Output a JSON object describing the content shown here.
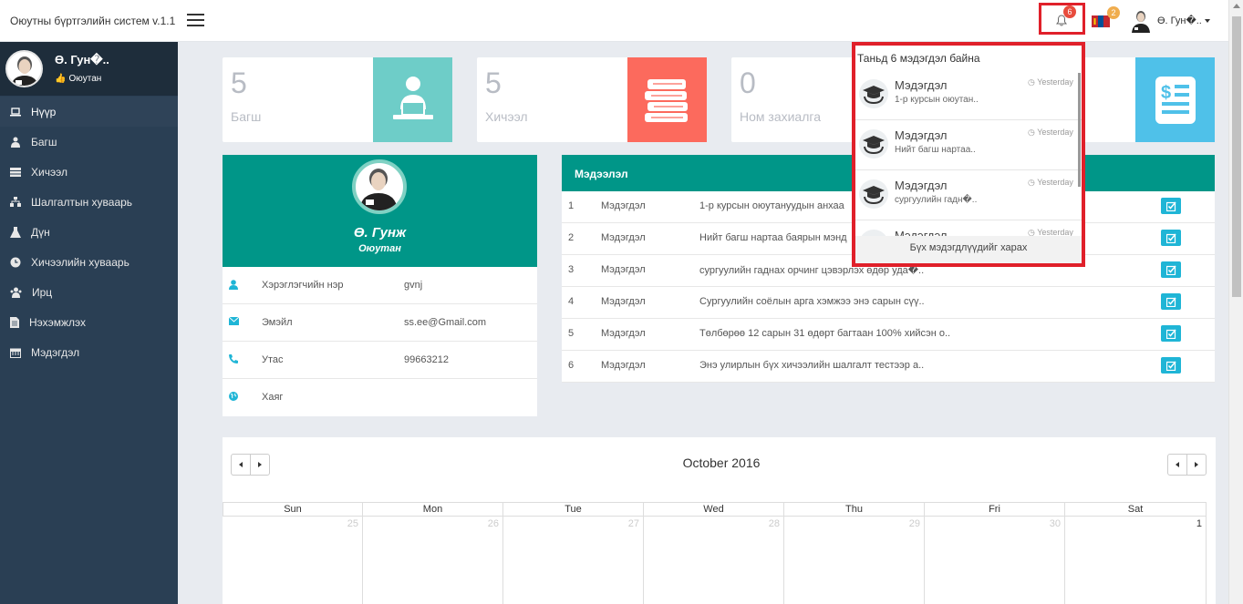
{
  "app": {
    "title": "Оюутны бүртгэлийн систем v.1.1"
  },
  "topbar": {
    "bell_count": "6",
    "flag_count": "2",
    "user_name": "Ө. Гун�.."
  },
  "sidebar": {
    "profile": {
      "name": "Ө. Гун�..",
      "role": "Оюутан"
    },
    "items": [
      {
        "label": "Нүүр",
        "icon": "laptop-icon"
      },
      {
        "label": "Багш",
        "icon": "teacher-icon"
      },
      {
        "label": "Хичээл",
        "icon": "book-icon"
      },
      {
        "label": "Шалгалтын хуваарь",
        "icon": "sitemap-icon"
      },
      {
        "label": "Дүн",
        "icon": "flask-icon"
      },
      {
        "label": "Хичээлийн хуваарь",
        "icon": "clock-icon"
      },
      {
        "label": "Ирц",
        "icon": "users-icon"
      },
      {
        "label": "Нэхэмжлэх",
        "icon": "file-icon"
      },
      {
        "label": "Мэдэгдэл",
        "icon": "calendar-icon"
      }
    ]
  },
  "stats": [
    {
      "value": "5",
      "label": "Багш",
      "color": "#6ecdc8",
      "icon": "teacher-laptop-icon"
    },
    {
      "value": "5",
      "label": "Хичээл",
      "color": "#fc6a5d",
      "icon": "books-icon"
    },
    {
      "value": "0",
      "label": "Ном захиалга",
      "color": "#4fc1e9",
      "icon": "invoice-icon"
    }
  ],
  "profile_card": {
    "name": "Ө. Гунж",
    "role": "Оюутан",
    "rows": [
      {
        "key": "Хэрэглэгчийн нэр",
        "value": "gvnj"
      },
      {
        "key": "Эмэйл",
        "value": "ss.ee@Gmail.com"
      },
      {
        "key": "Утас",
        "value": "99663212"
      },
      {
        "key": "Хаяг",
        "value": ""
      }
    ]
  },
  "news": {
    "title": "Мэдээлэл",
    "rows": [
      {
        "n": "1",
        "type": "Мэдэгдэл",
        "desc": "1-р курсын оюутануудын анхаа"
      },
      {
        "n": "2",
        "type": "Мэдэгдэл",
        "desc": "Нийт багш нартаа баярын мэнд"
      },
      {
        "n": "3",
        "type": "Мэдэгдэл",
        "desc": "сургуулийн гаднах орчинг цэвэрлэх өдөр уда�.."
      },
      {
        "n": "4",
        "type": "Мэдэгдэл",
        "desc": "Сургуулийн соёлын арга хэмжээ энэ сарын сүү.."
      },
      {
        "n": "5",
        "type": "Мэдэгдэл",
        "desc": "Төлбөрөө 12 сарын 31 өдөрт багтаан 100% хийсэн о.."
      },
      {
        "n": "6",
        "type": "Мэдэгдэл",
        "desc": "Энэ улирлын бүх хичээлийн шалгалт тестээр а.."
      }
    ]
  },
  "notifications": {
    "header": "Таньд 6 мэдэгдэл байна",
    "items": [
      {
        "title": "Мэдэгдэл",
        "desc": "1-р курсын оюутан..",
        "time": "Yesterday"
      },
      {
        "title": "Мэдэгдэл",
        "desc": "Нийт багш нартаа..",
        "time": "Yesterday"
      },
      {
        "title": "Мэдэгдэл",
        "desc": "сургуулийн гадн�..",
        "time": "Yesterday"
      },
      {
        "title": "Мэдэгдэл",
        "desc": "",
        "time": "Yesterday"
      }
    ],
    "view_all": "Бүх мэдэгдлүүдийг харах"
  },
  "calendar": {
    "title": "October 2016",
    "dow": [
      "Sun",
      "Mon",
      "Tue",
      "Wed",
      "Thu",
      "Fri",
      "Sat"
    ],
    "days": [
      "25",
      "26",
      "27",
      "28",
      "29",
      "30",
      "1"
    ]
  }
}
